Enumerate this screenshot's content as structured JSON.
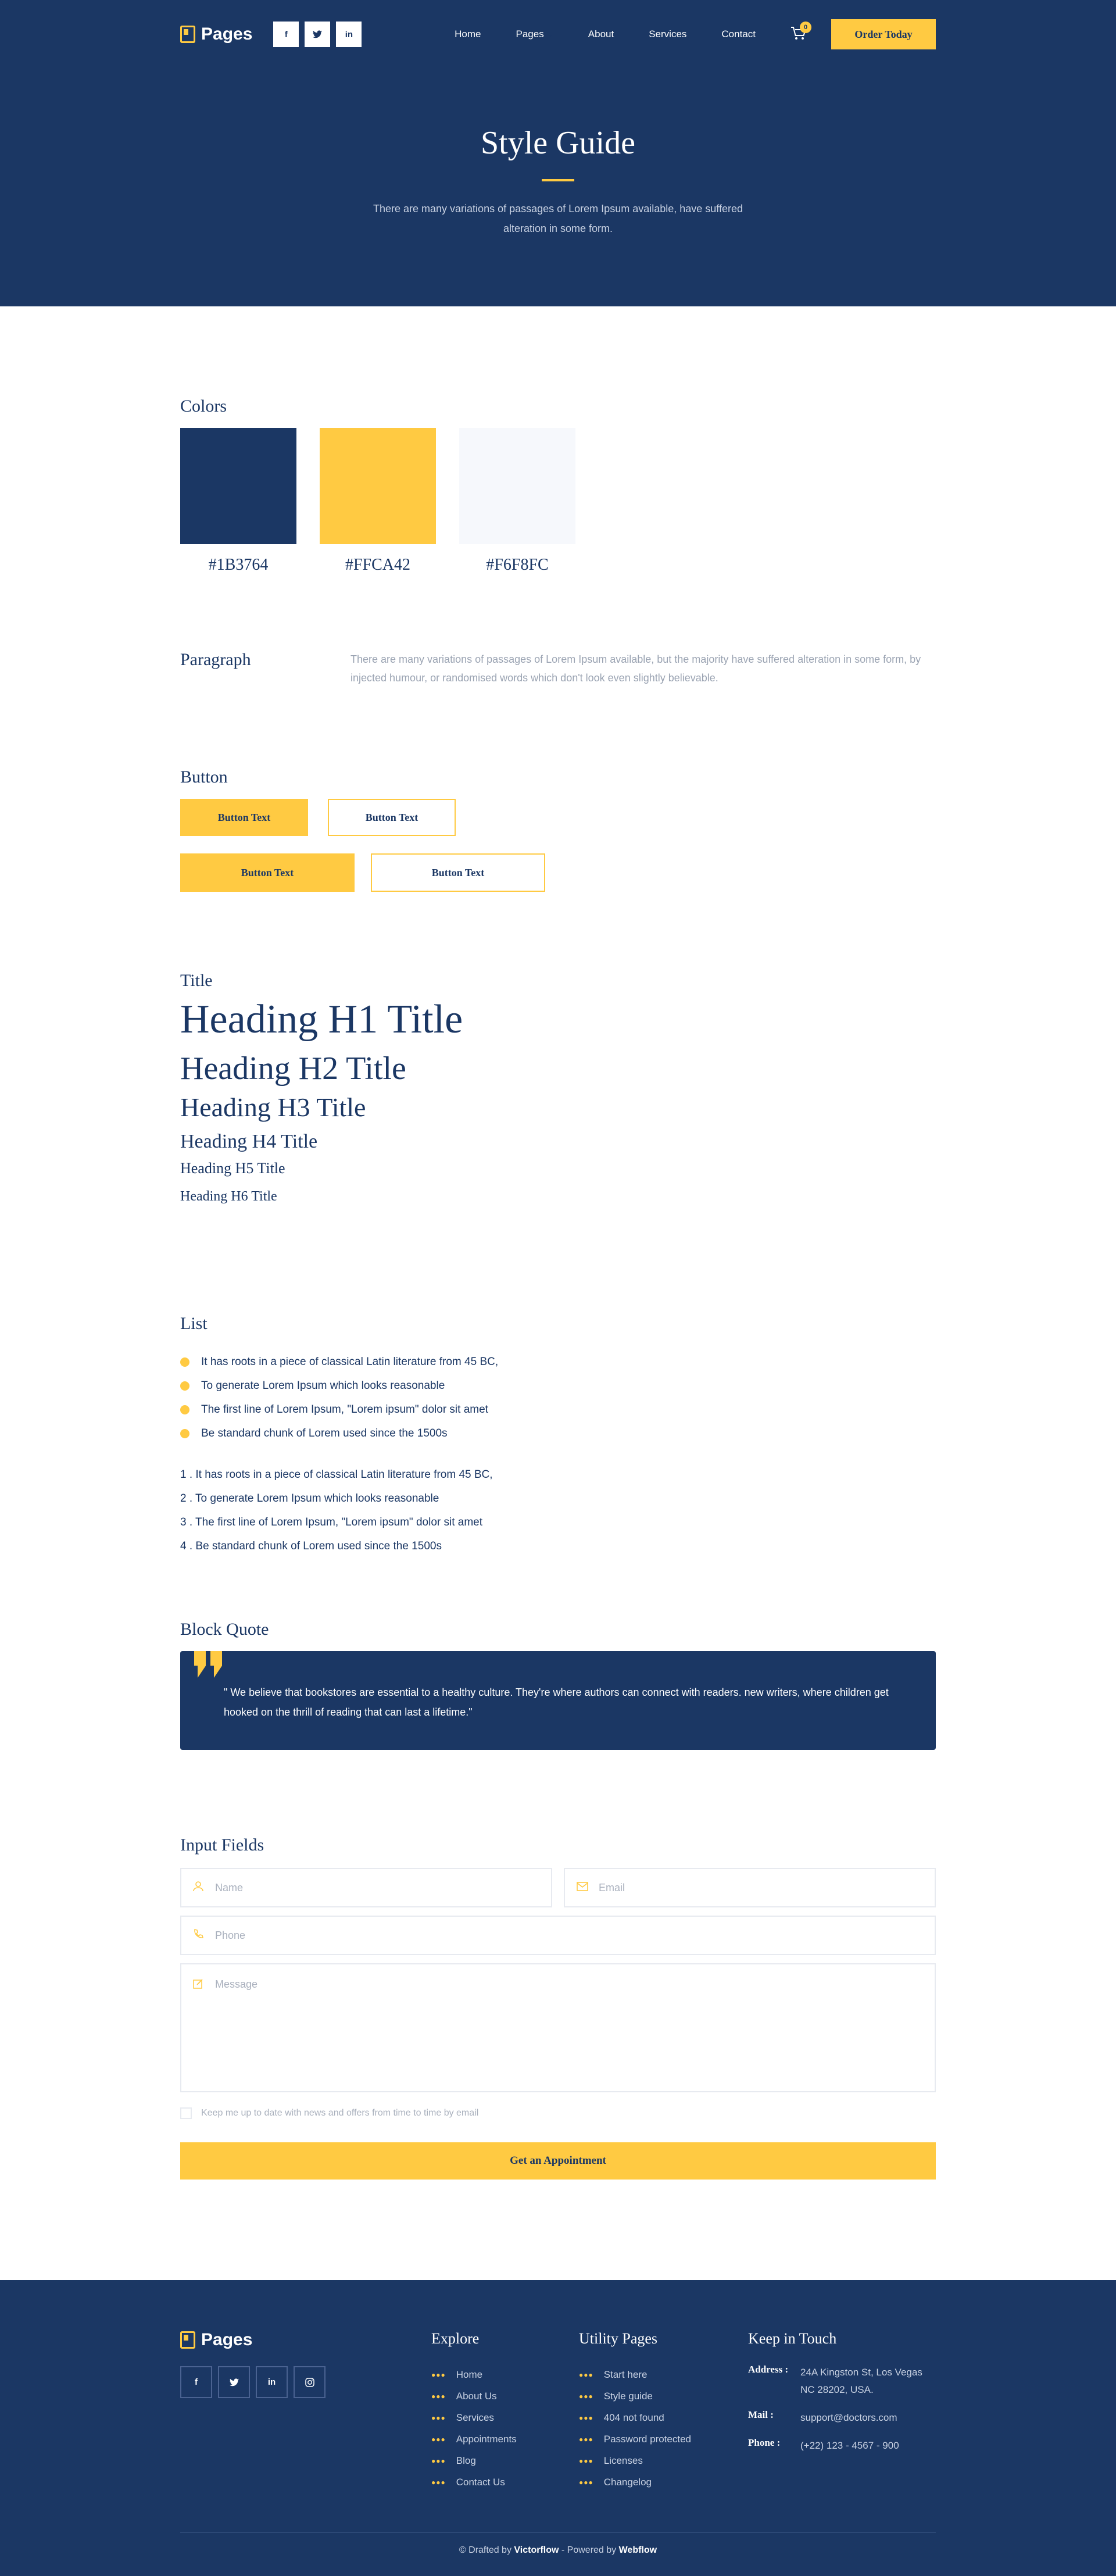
{
  "header": {
    "logo_text": "Pages",
    "socials": [
      "f",
      "t",
      "in"
    ],
    "nav": [
      "Home",
      "Pages",
      "About",
      "Services",
      "Contact"
    ],
    "cart_count": "0",
    "order_label": "Order Today"
  },
  "hero": {
    "title": "Style Guide",
    "description": "There are many variations of passages of Lorem Ipsum available,  have suffered alteration in some form."
  },
  "colors": {
    "title": "Colors",
    "swatches": [
      {
        "hex": "#1B3764",
        "label": "#1B3764"
      },
      {
        "hex": "#FFCA42",
        "label": "#FFCA42"
      },
      {
        "hex": "#F6F8FC",
        "label": "#F6F8FC"
      }
    ]
  },
  "paragraph": {
    "title": "Paragraph",
    "text": "There are many variations of passages of Lorem Ipsum available, but the majority have suffered alteration in some form, by injected humour, or randomised words which don't look even slightly believable."
  },
  "buttons": {
    "title": "Button",
    "label": "Button Text"
  },
  "typography": {
    "title": "Title",
    "h1": "Heading H1 Title",
    "h2": "Heading H2 Title",
    "h3": "Heading H3 Title",
    "h4": "Heading H4 Title",
    "h5": "Heading H5 Title",
    "h6": "Heading H6 Title"
  },
  "list": {
    "title": "List",
    "bullets": [
      "It has roots in a piece of classical Latin literature from 45 BC,",
      "To generate Lorem Ipsum which looks reasonable",
      "The first line of Lorem Ipsum, \"Lorem ipsum\" dolor sit amet",
      "Be standard chunk of Lorem used since the 1500s"
    ],
    "numbered": [
      "1 . It has roots in a piece of classical Latin literature from 45 BC,",
      "2 . To generate Lorem Ipsum which looks reasonable",
      "3 . The first line of Lorem Ipsum, \"Lorem ipsum\" dolor sit amet",
      "4 . Be standard chunk of Lorem used since the 1500s"
    ]
  },
  "quote": {
    "title": "Block Quote",
    "text": "\" We believe that bookstores are essential to a healthy culture. They're where authors can connect with readers. new writers, where children get hooked on the thrill of reading that can last a lifetime.\""
  },
  "form": {
    "title": "Input Fields",
    "name_placeholder": "Name",
    "email_placeholder": "Email",
    "phone_placeholder": "Phone",
    "message_placeholder": "Message",
    "checkbox_label": "Keep me up to date with news and offers from time to time by email",
    "submit_label": "Get an Appointment"
  },
  "footer": {
    "logo_text": "Pages",
    "socials": [
      "f",
      "t",
      "in",
      "ig"
    ],
    "explore_title": "Explore",
    "explore": [
      "Home",
      "About Us",
      "Services",
      "Appointments",
      "Blog",
      "Contact Us"
    ],
    "utility_title": "Utility Pages",
    "utility": [
      "Start here",
      "Style guide",
      "404 not found",
      "Password protected",
      "Licenses",
      "Changelog"
    ],
    "touch_title": "Keep in Touch",
    "address_label": "Address :",
    "address": "24A Kingston St, Los Vegas NC 28202, USA.",
    "mail_label": "Mail :",
    "mail": "support@doctors.com",
    "phone_label": "Phone :",
    "phone": "(+22) 123 - 4567 - 900",
    "copyright_pre": "© Drafted by ",
    "copyright_brand": "Victorflow",
    "copyright_mid": " - Powered by ",
    "copyright_platform": "Webflow"
  }
}
